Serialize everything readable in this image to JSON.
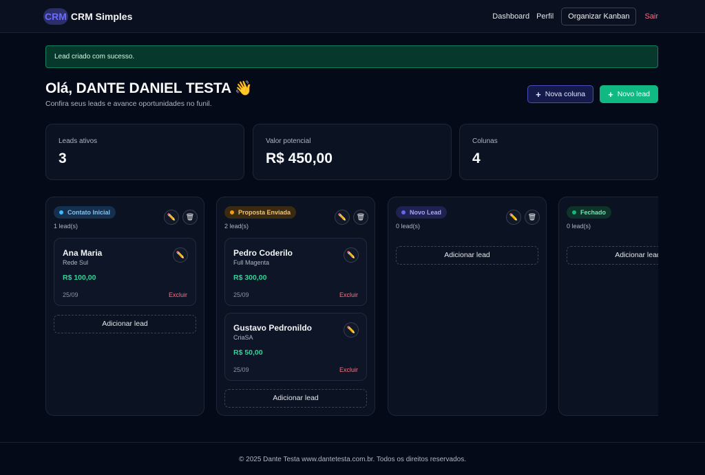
{
  "header": {
    "logo": "CRM",
    "brand": "CRM Simples",
    "nav": {
      "dashboard": "Dashboard",
      "profile": "Perfil",
      "kanban": "Organizar Kanban",
      "logout": "Sair"
    }
  },
  "alert": {
    "message": "Lead criado com sucesso."
  },
  "greeting": {
    "title": "Olá, DANTE DANIEL TESTA 👋",
    "subtitle": "Confira seus leads e avance oportunidades no funil."
  },
  "actions": {
    "new_column": "Nova coluna",
    "new_lead": "Novo lead",
    "plus": "+"
  },
  "stats": [
    {
      "label": "Leads ativos",
      "value": "3"
    },
    {
      "label": "Valor potencial",
      "value": "R$ 450,00"
    },
    {
      "label": "Colunas",
      "value": "4"
    }
  ],
  "icons": {
    "edit": "✏️",
    "trash": "🗑"
  },
  "columns": [
    {
      "title": "Contato Inicial",
      "count": "1 lead(s)",
      "badge_bg": "#15304f",
      "badge_color": "#7cc4f5",
      "dot": "#38bdf8",
      "cards": [
        {
          "name": "Ana Maria",
          "company": "Rede Sul",
          "value": "R$ 100,00",
          "date": "25/09",
          "delete": "Excluir"
        }
      ],
      "add": "Adicionar lead"
    },
    {
      "title": "Proposta Enviada",
      "count": "2 lead(s)",
      "badge_bg": "#3a2a12",
      "badge_color": "#f5c46b",
      "dot": "#f59e0b",
      "cards": [
        {
          "name": "Pedro Coderilo",
          "company": "Full Magenta",
          "value": "R$ 300,00",
          "date": "25/09",
          "delete": "Excluir"
        },
        {
          "name": "Gustavo Pedronildo",
          "company": "CriaSA",
          "value": "R$ 50,00",
          "date": "25/09",
          "delete": "Excluir"
        }
      ],
      "add": "Adicionar lead"
    },
    {
      "title": "Novo Lead",
      "count": "0 lead(s)",
      "badge_bg": "#1f2250",
      "badge_color": "#a5a8f5",
      "dot": "#6366f1",
      "cards": [],
      "add": "Adicionar lead"
    },
    {
      "title": "Fechado",
      "count": "0 lead(s)",
      "badge_bg": "#0e3328",
      "badge_color": "#6ee7b7",
      "dot": "#10b981",
      "cards": [],
      "add": "Adicionar lead"
    }
  ],
  "footer": {
    "text": "© 2025 Dante Testa www.dantetesta.com.br. Todos os direitos reservados."
  }
}
